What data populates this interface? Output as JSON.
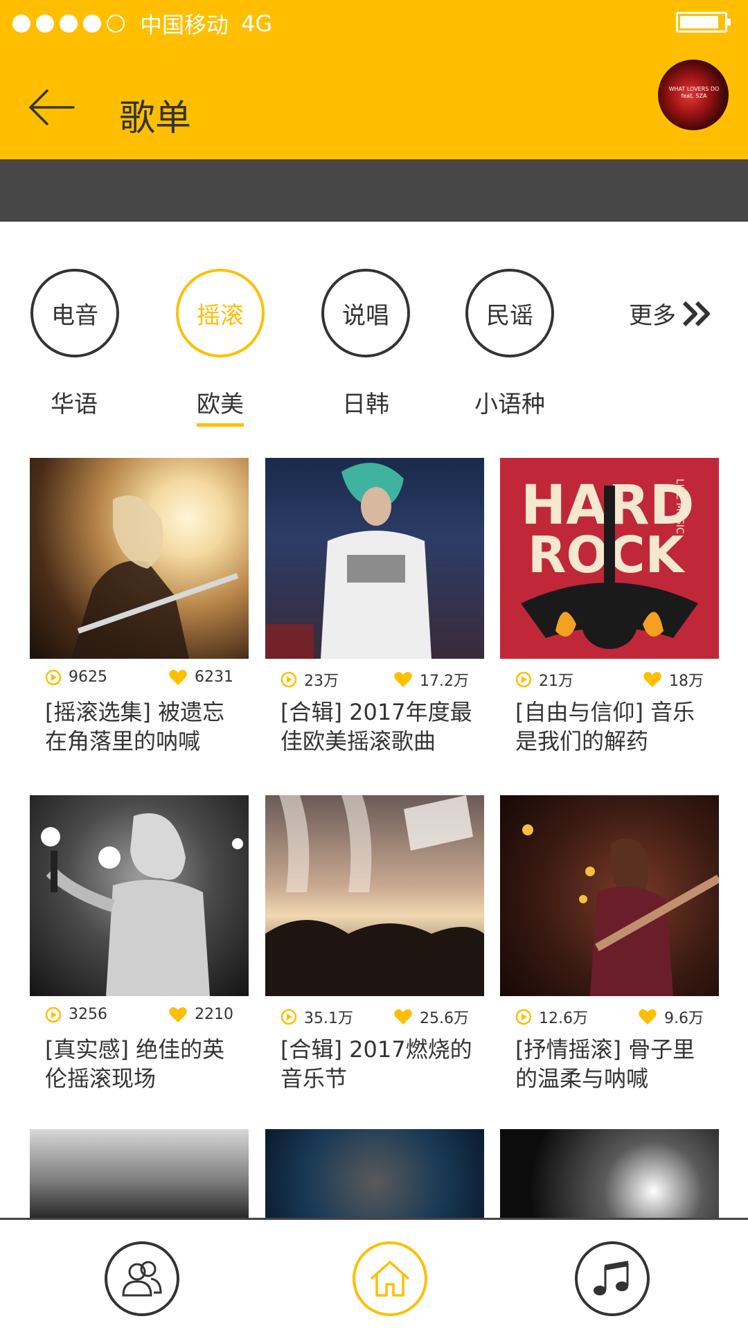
{
  "status": {
    "carrier": "中国移动",
    "network": "4G"
  },
  "header": {
    "title": "歌单",
    "album_text": "WHAT LOVERS DO feat. SZA"
  },
  "categories": [
    {
      "label": "电音",
      "active": false
    },
    {
      "label": "摇滚",
      "active": true
    },
    {
      "label": "说唱",
      "active": false
    },
    {
      "label": "民谣",
      "active": false
    }
  ],
  "more_label": "更多",
  "regions": [
    {
      "label": "华语",
      "active": false
    },
    {
      "label": "欧美",
      "active": true
    },
    {
      "label": "日韩",
      "active": false
    },
    {
      "label": "小语种",
      "active": false
    }
  ],
  "playlists": [
    {
      "plays": "9625",
      "likes": "6231",
      "title_line1": "[摇滚选集] 被遗忘",
      "title_line2": "在角落里的呐喊"
    },
    {
      "plays": "23万",
      "likes": "17.2万",
      "title_line1": "[合辑] 2017年度最",
      "title_line2": "佳欧美摇滚歌曲"
    },
    {
      "plays": "21万",
      "likes": "18万",
      "title_line1": "[自由与信仰] 音乐",
      "title_line2": "是我们的解药"
    },
    {
      "plays": "3256",
      "likes": "2210",
      "title_line1": "[真实感] 绝佳的英",
      "title_line2": "伦摇滚现场"
    },
    {
      "plays": "35.1万",
      "likes": "25.6万",
      "title_line1": "[合辑] 2017燃烧的",
      "title_line2": "音乐节"
    },
    {
      "plays": "12.6万",
      "likes": "9.6万",
      "title_line1": "[抒情摇滚] 骨子里",
      "title_line2": "的温柔与呐喊"
    }
  ],
  "cover3_text": {
    "line1": "HARD",
    "line2": "ROCK",
    "side": "LIVE MUSIC"
  },
  "colors": {
    "accent": "#FFBF00",
    "dark_bar": "#474747",
    "text": "#333333"
  },
  "bottom_nav": [
    {
      "icon": "friends-icon",
      "active": false
    },
    {
      "icon": "home-icon",
      "active": true
    },
    {
      "icon": "music-note-icon",
      "active": false
    }
  ]
}
